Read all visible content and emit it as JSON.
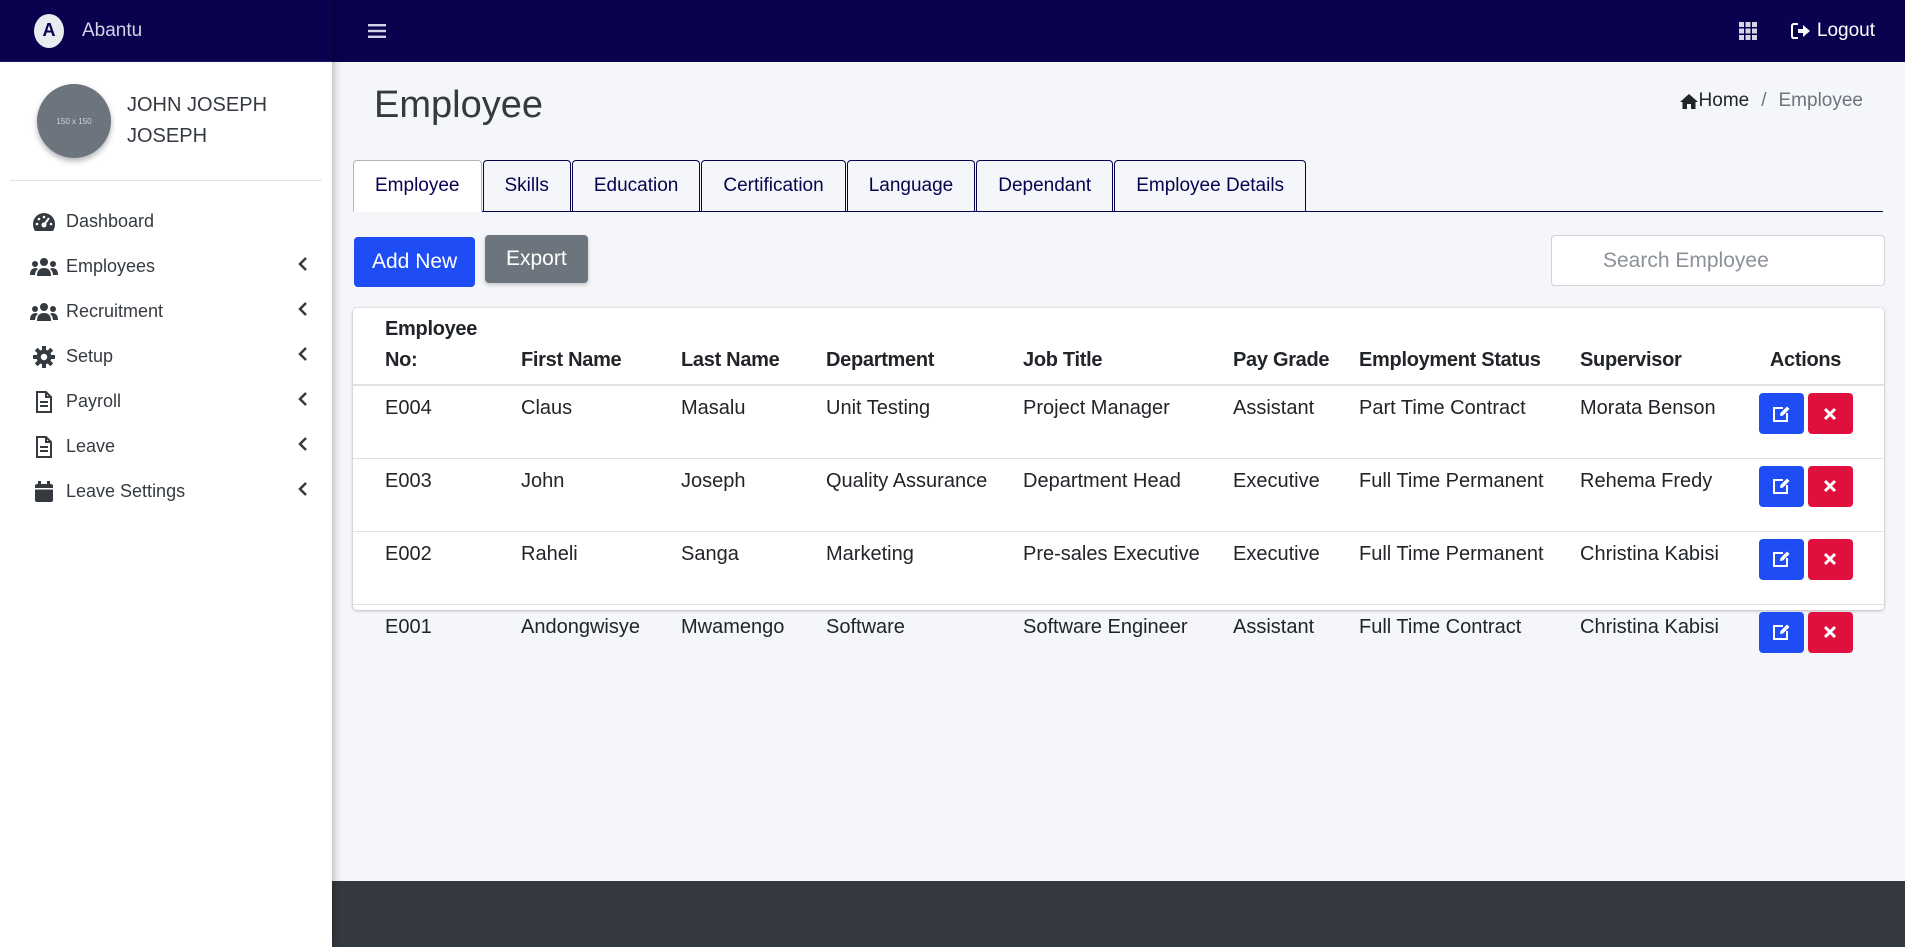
{
  "brand": {
    "name": "Abantu",
    "logo_letter": "A"
  },
  "user": {
    "name": "JOHN JOSEPH JOSEPH",
    "avatar_text": "150 x 150"
  },
  "sidebar": {
    "items": [
      {
        "label": "Dashboard",
        "icon": "dashboard-icon",
        "has_children": false
      },
      {
        "label": "Employees",
        "icon": "users-icon",
        "has_children": true
      },
      {
        "label": "Recruitment",
        "icon": "users-icon",
        "has_children": true
      },
      {
        "label": "Setup",
        "icon": "gear-icon",
        "has_children": true
      },
      {
        "label": "Payroll",
        "icon": "file-icon",
        "has_children": true
      },
      {
        "label": "Leave",
        "icon": "file-icon",
        "has_children": true
      },
      {
        "label": "Leave Settings",
        "icon": "calendar-icon",
        "has_children": true
      }
    ]
  },
  "topbar": {
    "logout_label": "Logout"
  },
  "page": {
    "title": "Employee"
  },
  "breadcrumb": {
    "home": "Home",
    "separator": "/",
    "current": "Employee"
  },
  "tabs": [
    {
      "label": "Employee",
      "active": true
    },
    {
      "label": "Skills",
      "active": false
    },
    {
      "label": "Education",
      "active": false
    },
    {
      "label": "Certification",
      "active": false
    },
    {
      "label": "Language",
      "active": false
    },
    {
      "label": "Dependant",
      "active": false
    },
    {
      "label": "Employee Details",
      "active": false
    }
  ],
  "toolbar": {
    "add_label": "Add New",
    "export_label": "Export",
    "search_placeholder": "Search Employee"
  },
  "table": {
    "headers": [
      "Employee No:",
      "First Name",
      "Last Name",
      "Department",
      "Job Title",
      "Pay Grade",
      "Employment Status",
      "Supervisor",
      "Actions"
    ],
    "rows": [
      [
        "E004",
        "Claus",
        "Masalu",
        "Unit Testing",
        "Project Manager",
        "Assistant",
        "Part Time Contract",
        "Morata Benson"
      ],
      [
        "E003",
        "John",
        "Joseph",
        "Quality Assurance",
        "Department Head",
        "Executive",
        "Full Time Permanent",
        "Rehema Fredy"
      ],
      [
        "E002",
        "Raheli",
        "Sanga",
        "Marketing",
        "Pre-sales Executive",
        "Executive",
        "Full Time Permanent",
        "Christina Kabisi"
      ],
      [
        "E001",
        "Andongwisye",
        "Mwamengo",
        "Software",
        "Software Engineer",
        "Assistant",
        "Full Time Contract",
        "Christina Kabisi"
      ]
    ]
  },
  "colors": {
    "navbar": "#09024f",
    "primary": "#1e4cf5",
    "danger": "#e0103e",
    "secondary": "#6c757d",
    "footer": "#343a40"
  }
}
